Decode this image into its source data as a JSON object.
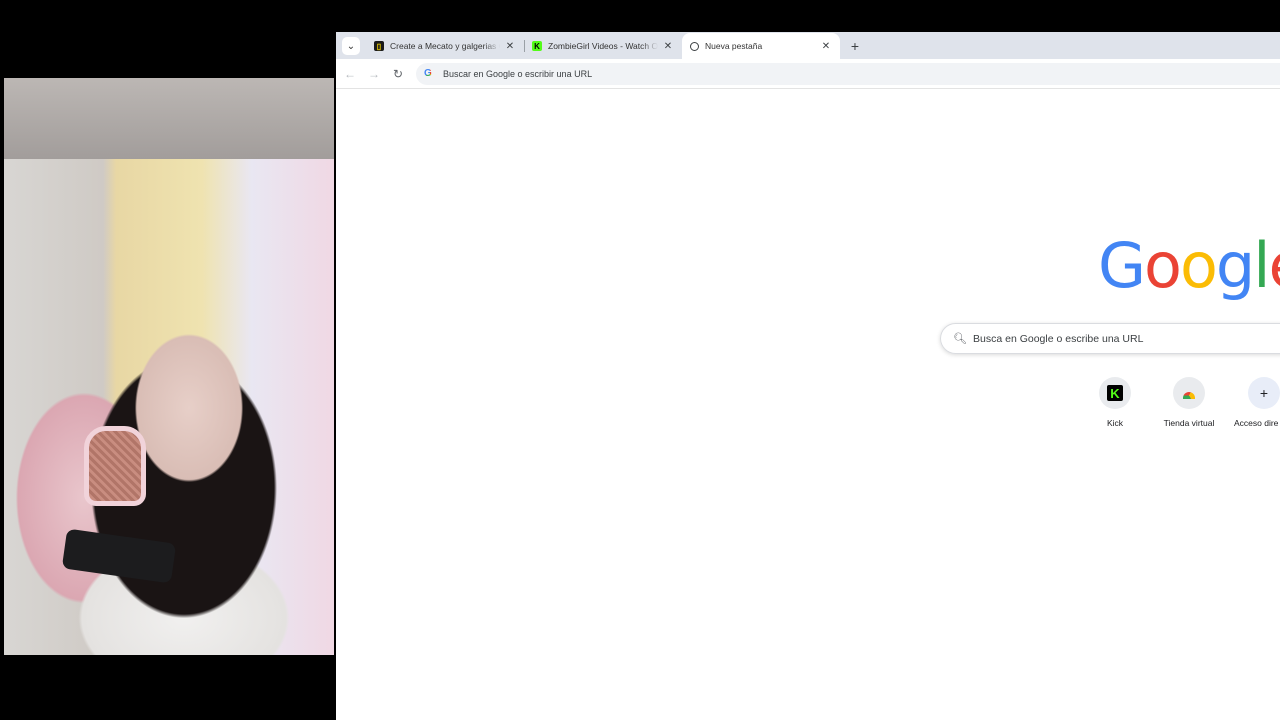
{
  "tabs": [
    {
      "title": "Create a Mecato y galgerias Col",
      "favicon": "buymeacoffee-icon",
      "active": false
    },
    {
      "title": "ZombieGirl Videos - Watch Onl",
      "favicon": "kick-icon",
      "active": false
    },
    {
      "title": "Nueva pestaña",
      "favicon": "chrome-icon",
      "active": true
    }
  ],
  "omnibox": {
    "placeholder": "Buscar en Google o escribir una URL"
  },
  "ntp": {
    "logo": [
      "G",
      "o",
      "o",
      "g",
      "l",
      "e"
    ],
    "search_placeholder": "Busca en Google o escribe una URL",
    "shortcuts": [
      {
        "label": "Kick",
        "icon": "kick-icon"
      },
      {
        "label": "Tienda virtual",
        "icon": "webstore-icon"
      },
      {
        "label": "Acceso dire",
        "icon": "plus-icon"
      }
    ]
  },
  "colors": {
    "blue": "#4285f4",
    "red": "#ea4335",
    "yellow": "#fbbc05",
    "green": "#34a853",
    "kick_green": "#53fc18",
    "tabstrip": "#dfe3eb"
  }
}
